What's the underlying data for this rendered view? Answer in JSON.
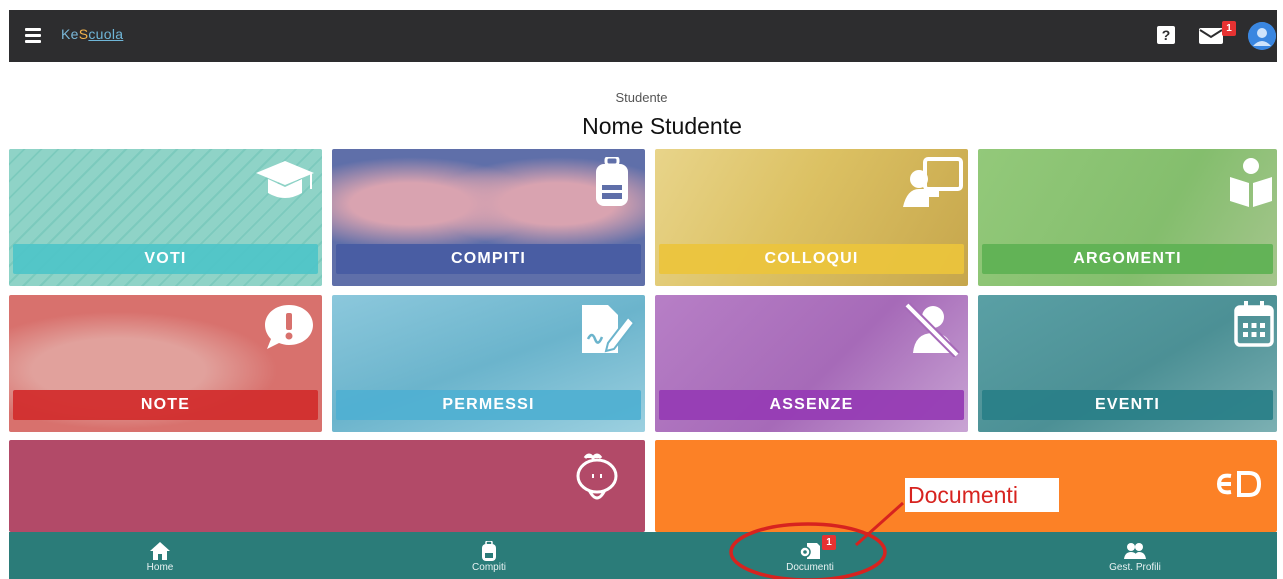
{
  "app": {
    "logo_text_1": "Ke",
    "logo_text_2": "S",
    "logo_text_3": "cuola",
    "help_label": "?",
    "mail_badge": "1"
  },
  "header": {
    "role": "Studente",
    "student_name": "Nome Studente"
  },
  "tiles": {
    "voti": "VOTI",
    "compiti": "COMPITI",
    "colloqui": "COLLOQUI",
    "argomenti": "ARGOMENTI",
    "note": "NOTE",
    "permessi": "PERMESSI",
    "assenze": "ASSENZE",
    "eventi": "EVENTI"
  },
  "annotation": {
    "documenti_label": "Documenti"
  },
  "bottom_nav": {
    "items": [
      {
        "label": "Home",
        "icon": "home-icon"
      },
      {
        "label": "Compiti",
        "icon": "backpack-icon"
      },
      {
        "label": "Documenti",
        "icon": "documents-icon",
        "badge": "1"
      },
      {
        "label": "Gest. Profili",
        "icon": "users-icon"
      }
    ]
  },
  "colors": {
    "topbar": "#2d2d2f",
    "bottom_nav": "#2b7c79",
    "badge": "#e63232",
    "annotation_red": "#d7231f",
    "tile_pink": "#b24a68",
    "tile_orange": "#fc8126"
  }
}
